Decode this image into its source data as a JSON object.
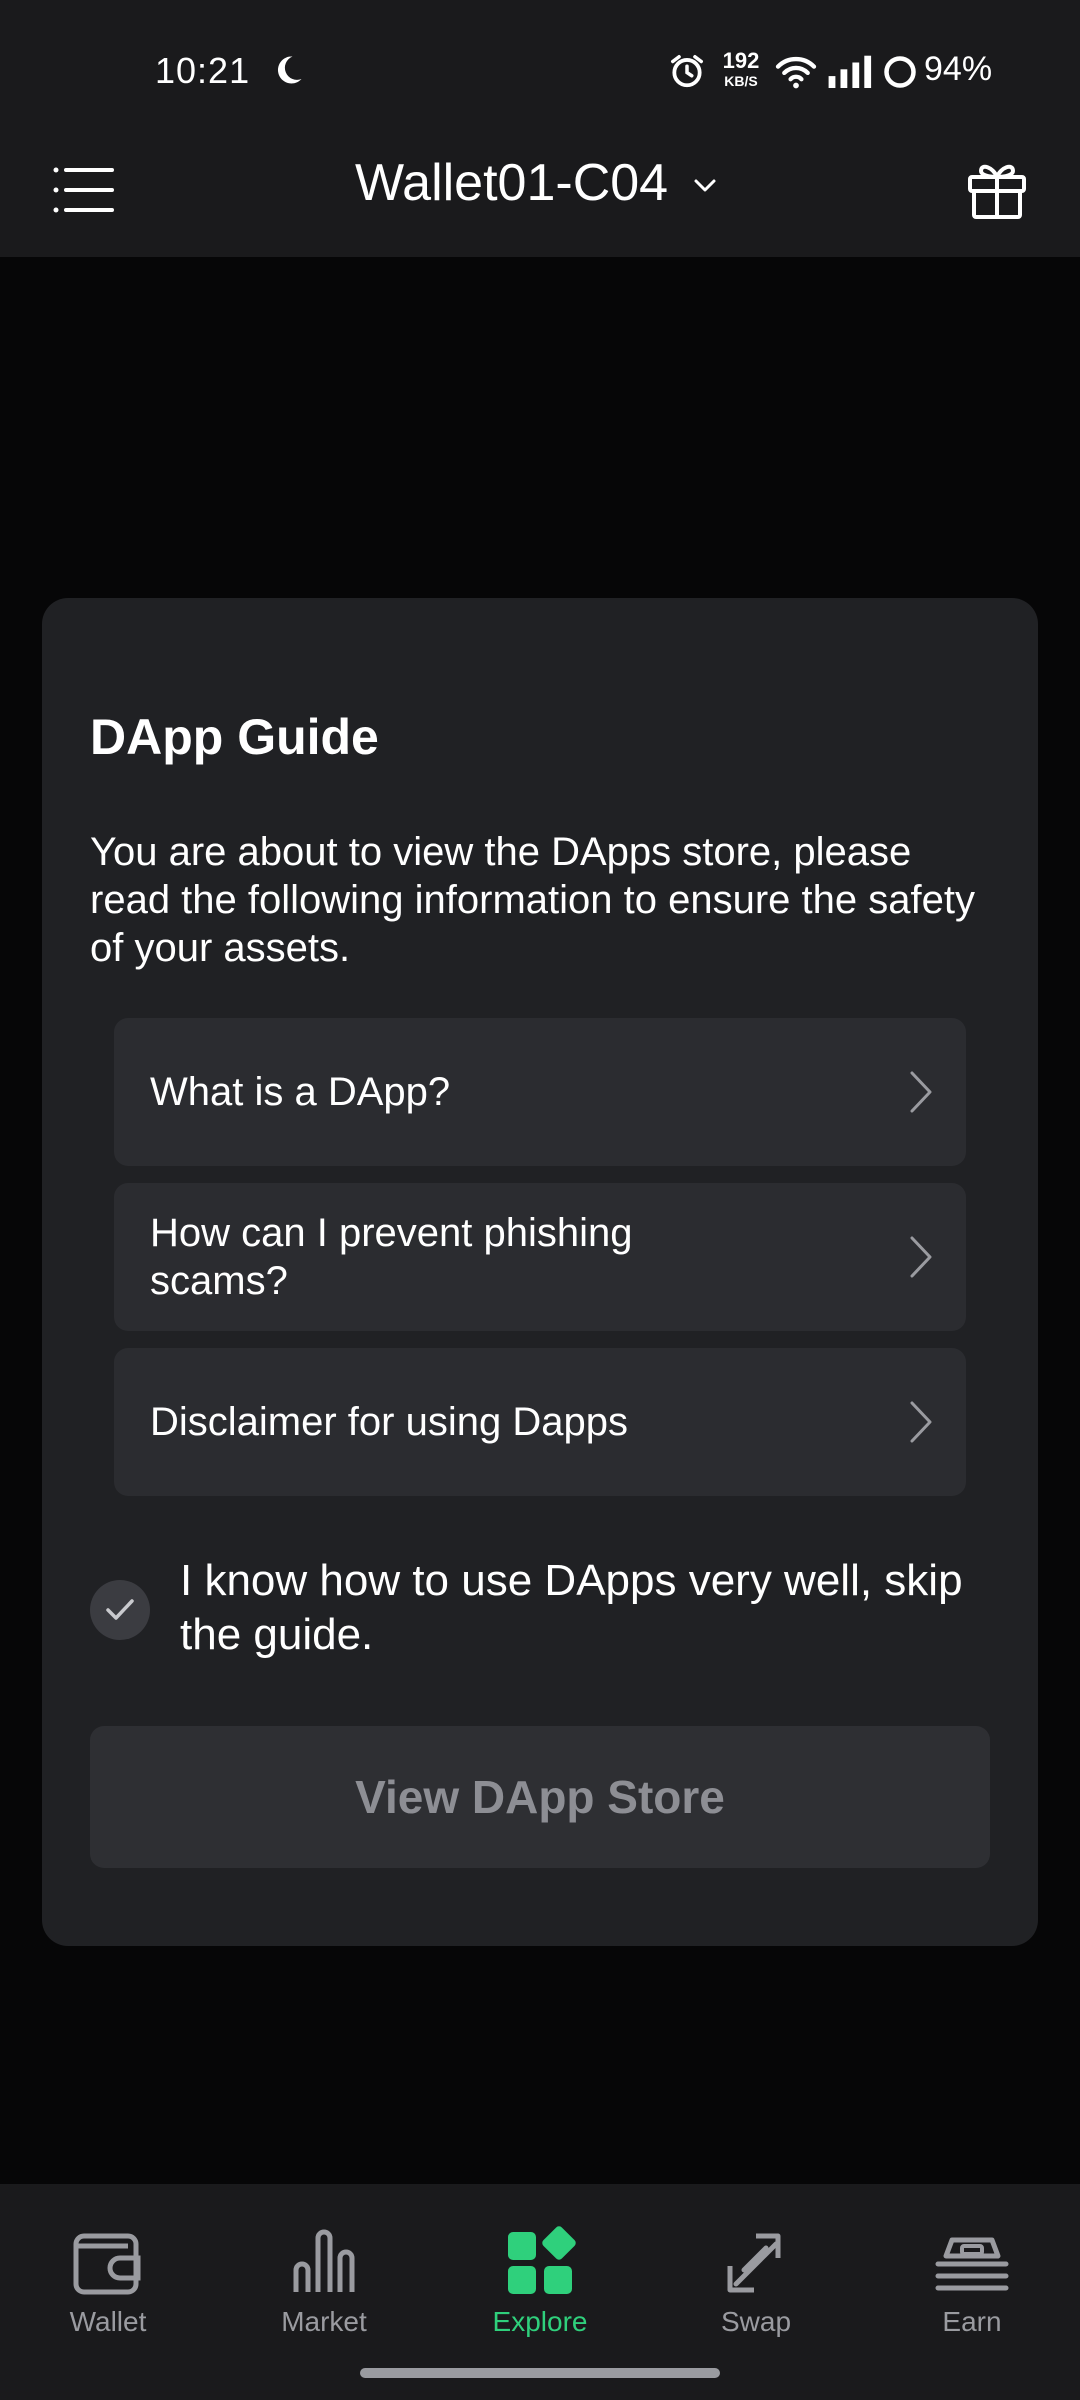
{
  "status": {
    "time": "10:21",
    "net_speed": "192",
    "net_unit": "KB/S",
    "battery": "94%"
  },
  "header": {
    "wallet_name": "Wallet01-C04",
    "icons": [
      "menu-icon",
      "chevron-down-icon",
      "gift-icon"
    ]
  },
  "guide": {
    "title": "DApp Guide",
    "description": "You are about to view the DApps store, please read the following information to ensure the safety of your assets.",
    "items": [
      {
        "label": "What is a DApp?"
      },
      {
        "label": "How can I prevent phishing scams?"
      },
      {
        "label": "Disclaimer for using Dapps"
      }
    ],
    "skip_label": "I know how to use DApps very well, skip the guide.",
    "button_label": "View DApp Store"
  },
  "tabs": [
    {
      "label": "Wallet",
      "icon": "wallet-icon"
    },
    {
      "label": "Market",
      "icon": "market-icon"
    },
    {
      "label": "Explore",
      "icon": "explore-icon",
      "active": true
    },
    {
      "label": "Swap",
      "icon": "swap-icon"
    },
    {
      "label": "Earn",
      "icon": "earn-icon"
    }
  ],
  "colors": {
    "accent": "#2fd07c",
    "background": "#060607",
    "card": "#202124"
  }
}
